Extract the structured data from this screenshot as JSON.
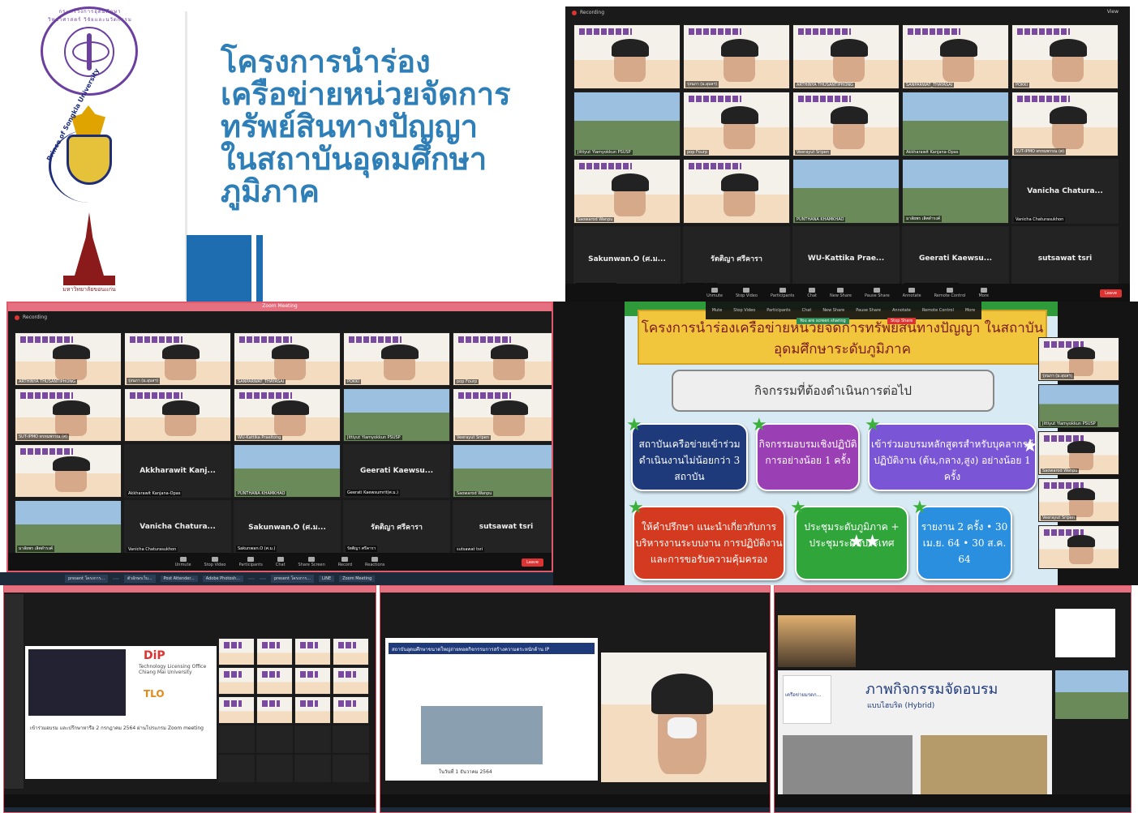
{
  "title_panel": {
    "title_lines": [
      "โครงการนำร่อง",
      "เครือข่ายหน่วยจัดการ",
      "ทรัพย์สินทางปัญญา",
      "ในสถาบันอุดมศึกษา",
      "ภูมิภาค"
    ],
    "logo_psu_text": "Prince of Songkla University",
    "logo_kku_text": "มหาวิทยาลัยขอนแก่น"
  },
  "zoom_top": {
    "recording_label": "Recording",
    "view_label": "View",
    "tiles": [
      {
        "tag": "",
        "kind": "poster"
      },
      {
        "tag": "รุ่งนภา (ม.อุบลฯ)",
        "kind": "poster"
      },
      {
        "tag": "ARTHINYA THUSANTIPHONG",
        "kind": "poster"
      },
      {
        "tag": "SANPARWAT_THAYASAI",
        "kind": "poster"
      },
      {
        "tag": "POKKI",
        "kind": "poster"
      },
      {
        "tag": "Jittiyut Yiamyokkun PSUSP",
        "kind": "scene"
      },
      {
        "tag": "pop Fourp",
        "kind": "poster"
      },
      {
        "tag": "Veerayut Sripen",
        "kind": "poster"
      },
      {
        "tag": "Akkharawit Kanjana-Opas",
        "kind": "scene"
      },
      {
        "tag": "SUT-IPMO พรหมพรรณ (ศ)",
        "kind": "poster"
      },
      {
        "tag": "Saowarod Wanpu",
        "kind": "poster"
      },
      {
        "tag": "",
        "kind": "poster"
      },
      {
        "tag": "PUNTHANA KHAMKHAO",
        "kind": "scene"
      },
      {
        "tag": "มาลัยพร เลิศดำรงค์",
        "kind": "scene"
      },
      {
        "tag": "Vanicha Chaturasukhon",
        "kind": "dark",
        "name": "Vanicha  Chatura..."
      },
      {
        "tag": "Sakunwan.O (ศ.ม.)",
        "kind": "dark",
        "name": "Sakunwan.O  (ศ.ม..."
      },
      {
        "tag": "รัตติญา ศรีคารา",
        "kind": "dark",
        "name": "รัตติญา ศรีคารา"
      },
      {
        "tag": "WU-Kattika Praeitong",
        "kind": "dark",
        "name": "WU-Kattika  Prae..."
      },
      {
        "tag": "Geerati Kaewsumrit(ศ.ม.)",
        "kind": "dark",
        "name": "Geerati  Kaewsu..."
      },
      {
        "tag": "sutsawat tsri",
        "kind": "dark",
        "name": "sutsawat  tsri"
      }
    ],
    "controls": [
      "Unmute",
      "Stop Video",
      "Participants",
      "Chat",
      "New Share",
      "Pause Share",
      "Annotate",
      "Remote Control",
      "More"
    ],
    "leave_label": "Leave"
  },
  "zoom_mid": {
    "window_title": "Zoom Meeting",
    "recording_label": "Recording",
    "tiles": [
      {
        "tag": "ARTHINYA THUSANTIPHONG",
        "kind": "poster"
      },
      {
        "tag": "รุ่งนภา (ม.อุบลฯ)",
        "kind": "poster"
      },
      {
        "tag": "SANPARWAT_THAYASAI",
        "kind": "poster"
      },
      {
        "tag": "POKKI",
        "kind": "poster"
      },
      {
        "tag": "pop Fourp",
        "kind": "poster"
      },
      {
        "tag": "SUT-IPMO พรหมพรรณ (ศ)",
        "kind": "poster"
      },
      {
        "tag": "",
        "kind": "poster"
      },
      {
        "tag": "WU-Kattika Praeitong",
        "kind": "poster"
      },
      {
        "tag": "Jittiyut Yiamyokkun PSUSP",
        "kind": "scene"
      },
      {
        "tag": "Veerayut Sripen",
        "kind": "poster"
      },
      {
        "tag": "",
        "kind": "poster"
      },
      {
        "tag": "Akkharawit Kanjana-Opas",
        "kind": "dark",
        "name": "Akkharawit  Kanj..."
      },
      {
        "tag": "PUNTHANA KHAMKHAO",
        "kind": "scene"
      },
      {
        "tag": "Geerati Kaewsumrit(ศ.ม.)",
        "kind": "dark",
        "name": "Geerati  Kaewsu..."
      },
      {
        "tag": "Saowarod Wanpu",
        "kind": "scene"
      },
      {
        "tag": "มาลัยพร เลิศดำรงค์",
        "kind": "scene"
      },
      {
        "tag": "Vanicha Chaturasukhon",
        "kind": "dark",
        "name": "Vanicha  Chatura..."
      },
      {
        "tag": "Sakunwan.O (ศ.ม.)",
        "kind": "dark",
        "name": "Sakunwan.O  (ศ.ม..."
      },
      {
        "tag": "รัตติญา ศรีคารา",
        "kind": "dark",
        "name": "รัตติญา ศรีคารา"
      },
      {
        "tag": "sutsawat tsri",
        "kind": "dark",
        "name": "sutsawat  tsri"
      }
    ],
    "controls": [
      "Unmute",
      "Stop Video",
      "Participants",
      "Chat",
      "Share Screen",
      "Record",
      "Reactions"
    ],
    "leave_label": "Leave"
  },
  "taskbar": {
    "items": [
      "present โครงการ...",
      "",
      "ตัวอักษรเว็บ...",
      "Post Attender...",
      "Adobe Photosh...",
      "",
      "",
      "present โครงการ...",
      "LINE",
      "Zoom Meeting"
    ]
  },
  "slide": {
    "header": "โครงการนำร่องเครือข่ายหน่วยจัดการทรัพย์สินทางปัญญา ในสถาบันอุดมศึกษาระดับภูมิภาค",
    "subheader": "กิจกรรมที่ต้องดำเนินการต่อไป",
    "boxes": [
      "สถาบันเครือข่ายเข้าร่วมดำเนินงานไม่น้อยกว่า 3 สถาบัน",
      "กิจกรรมอบรมเชิงปฏิบัติการอย่างน้อย 1 ครั้ง",
      "เข้าร่วมอบรมหลักสูตรสำหรับบุคลากรผู้ปฏิบัติงาน (ต้น,กลาง,สูง) อย่างน้อย 1 ครั้ง",
      "ให้คำปรึกษา แนะนำเกี่ยวกับการบริหารงานระบบงาน การปฏิบัติงานและการขอรับความคุ้มครอง",
      "ประชุมระดับภูมิภาค + ประชุมระดับประเทศ",
      "รายงาน 2 ครั้ง • 30 เม.ย. 64 • 30 ส.ค. 64"
    ],
    "zoom_controls": [
      "Mute",
      "Stop Video",
      "Participants",
      "Chat",
      "New Share",
      "Pause Share",
      "Annotate",
      "Remote Control",
      "More"
    ],
    "share_message": "You are screen sharing",
    "stop_share": "Stop Share",
    "side_tags": [
      "รุ่งนภา (ม.อุบลฯ)",
      "Jittiyut Yiamyokkun PSUSP",
      "Saowarod Wanpu",
      "Veerayut Sripen",
      ""
    ]
  },
  "bottom_left": {
    "dip_text": "DiP",
    "office_text": "Technology Licensing Office Chiang Mai University",
    "tlo_text": "TLO",
    "caption": "เข้าร่วมอบรม และปรึกษาหารือ 2 กรกฎาคม 2564 ผ่านโปรแกรม Zoom meeting"
  },
  "bottom_mid": {
    "heading": "สถาบันอุดมศึกษาขนาดใหญ่ถ่ายทอดกิจกรรมการสร้างความตระหนักด้าน IP",
    "caption": "ในวันที่ 1 ธันวาคม 2564"
  },
  "bottom_right": {
    "heading": "ภาพกิจกรรมจัดอบรม",
    "sub": "แบบไฮบริด (Hybrid)",
    "poster_text": "เครือข่ายมรดก..."
  }
}
